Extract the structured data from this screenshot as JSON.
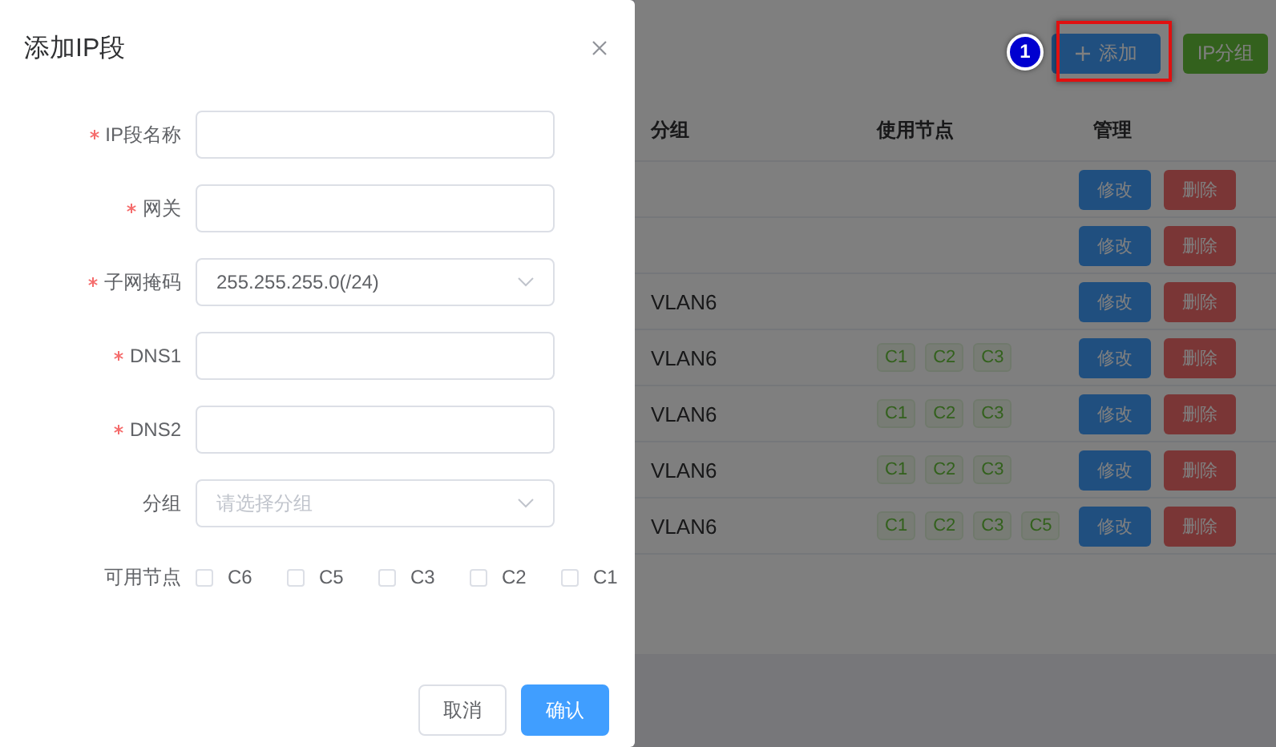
{
  "toolbar": {
    "buttons": [
      {
        "label": "添加",
        "kind": "primary",
        "highlighted": true,
        "callout": "1"
      },
      {
        "label": "IP分组",
        "kind": "success",
        "highlighted": false
      }
    ]
  },
  "table": {
    "columns": [
      "分组",
      "使用节点",
      "管理"
    ],
    "rows": [
      {
        "nodes": [],
        "actions": [
          {
            "label": "修改",
            "kind": "edit"
          },
          {
            "label": "删除",
            "kind": "delete"
          }
        ]
      },
      {
        "nodes": [],
        "actions": [
          {
            "label": "修改",
            "kind": "edit"
          },
          {
            "label": "删除",
            "kind": "delete"
          }
        ]
      },
      {
        "group": "VLAN6",
        "nodes": [],
        "actions": [
          {
            "label": "修改",
            "kind": "edit"
          },
          {
            "label": "删除",
            "kind": "delete"
          }
        ]
      },
      {
        "group": "VLAN6",
        "nodes": [
          "C1",
          "C2",
          "C3"
        ],
        "actions": [
          {
            "label": "修改",
            "kind": "edit"
          },
          {
            "label": "删除",
            "kind": "delete"
          }
        ]
      },
      {
        "group": "VLAN6",
        "nodes": [
          "C1",
          "C2",
          "C3"
        ],
        "actions": [
          {
            "label": "修改",
            "kind": "edit"
          },
          {
            "label": "删除",
            "kind": "delete"
          }
        ]
      },
      {
        "group": "VLAN6",
        "nodes": [
          "C1",
          "C2",
          "C3"
        ],
        "actions": [
          {
            "label": "修改",
            "kind": "edit"
          },
          {
            "label": "删除",
            "kind": "delete"
          }
        ]
      },
      {
        "group": "VLAN6",
        "nodes": [
          "C1",
          "C2",
          "C3",
          "C5"
        ],
        "actions": [
          {
            "label": "修改",
            "kind": "edit"
          },
          {
            "label": "删除",
            "kind": "delete"
          }
        ]
      }
    ]
  },
  "dialog": {
    "title": "添加IP段",
    "fields": [
      {
        "label": "IP段名称",
        "required": true,
        "kind": "input"
      },
      {
        "label": "网关",
        "required": true,
        "kind": "input"
      },
      {
        "label": "子网掩码",
        "required": true,
        "kind": "select",
        "value": "255.255.255.0(/24)"
      },
      {
        "label": "DNS1",
        "required": true,
        "kind": "input"
      },
      {
        "label": "DNS2",
        "required": true,
        "kind": "input"
      },
      {
        "label": "分组",
        "required": false,
        "kind": "select",
        "placeholder": "请选择分组"
      }
    ],
    "nodes": {
      "label": "可用节点",
      "options": [
        {
          "label": "C6",
          "checked": false
        },
        {
          "label": "C5",
          "checked": false
        },
        {
          "label": "C3",
          "checked": false
        },
        {
          "label": "C2",
          "checked": false
        },
        {
          "label": "C1",
          "checked": false
        }
      ]
    },
    "buttons": [
      {
        "label": "取消",
        "kind": "default"
      },
      {
        "label": "确认",
        "kind": "primary"
      }
    ]
  }
}
